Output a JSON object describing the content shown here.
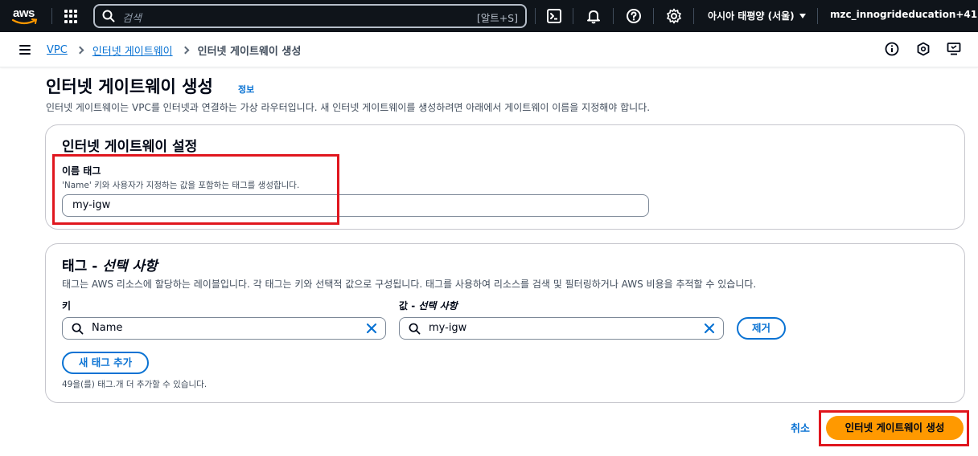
{
  "topnav": {
    "logo_text": "aws",
    "search_placeholder": "검색",
    "search_shortcut": "[알트+S]",
    "region": "아시아 태평양 (서울)",
    "account": "mzc_innogrideducation+41"
  },
  "breadcrumb": {
    "items": [
      "VPC",
      "인터넷 게이트웨이"
    ],
    "current": "인터넷 게이트웨이 생성"
  },
  "page": {
    "title": "인터넷 게이트웨이 생성",
    "info": "정보",
    "description": "인터넷 게이트웨이는 VPC를 인터넷과 연결하는 가상 라우터입니다. 새 인터넷 게이트웨이를 생성하려면 아래에서 게이트웨이 이름을 지정해야 합니다."
  },
  "settings": {
    "title": "인터넷 게이트웨이 설정",
    "name_tag_label": "이름 태그",
    "name_tag_hint": "'Name' 키와 사용자가 지정하는 값을 포함하는 태그를 생성합니다.",
    "name_tag_value": "my-igw"
  },
  "tags": {
    "title_main": "태그 - ",
    "title_optional": "선택 사항",
    "description": "태그는 AWS 리소스에 할당하는 레이블입니다. 각 태그는 키와 선택적 값으로 구성됩니다. 태그를 사용하여 리소스를 검색 및 필터링하거나 AWS 비용을 추적할 수 있습니다.",
    "key_label": "키",
    "value_label_main": "값 - ",
    "value_label_optional": "선택 사항",
    "key_value": "Name",
    "value_value": "my-igw",
    "remove_label": "제거",
    "add_label": "새 태그 추가",
    "remaining_hint": "49을(를) 태그.개 더 추가할 수 있습니다."
  },
  "footer": {
    "cancel_label": "취소",
    "create_label": "인터넷 게이트웨이 생성"
  },
  "colors": {
    "nav_bg": "#0f141a",
    "link": "#0972d3",
    "primary": "#ff9900",
    "highlight": "#e0161e"
  }
}
